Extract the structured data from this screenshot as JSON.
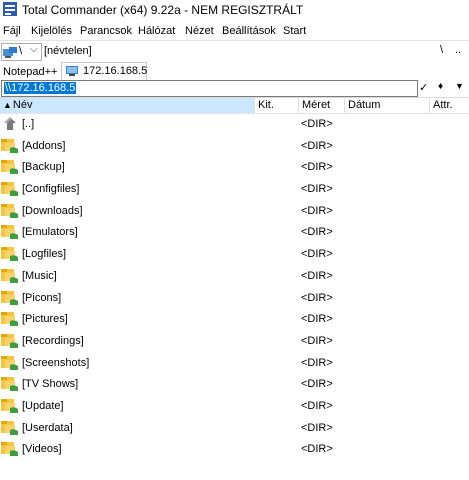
{
  "window": {
    "title": "Total Commander (x64) 9.22a - NEM REGISZTRÁLT"
  },
  "menu": [
    "Fájl",
    "Kijelölés",
    "Parancsok",
    "Hálózat",
    "Nézet",
    "Beállítások",
    "Start"
  ],
  "drivebar": {
    "drive": "\\",
    "volume_label": "[névtelen]",
    "root_button": "\\",
    "up_button": ".."
  },
  "tabs": [
    {
      "label": "Notepad++"
    },
    {
      "label": "172.16.168.5"
    }
  ],
  "path": {
    "value": "\\\\172.16.168.5",
    "check": "✓",
    "history": "♦",
    "dropdown": "▼"
  },
  "columns": {
    "name": "Név",
    "ext": "Kit.",
    "size": "Méret",
    "date": "Dátum",
    "attr": "Attr."
  },
  "files": [
    {
      "name": "[..]",
      "size": "<DIR>",
      "icon": "up-folder-icon"
    },
    {
      "name": "[Addons]",
      "size": "<DIR>",
      "icon": "folder-icon"
    },
    {
      "name": "[Backup]",
      "size": "<DIR>",
      "icon": "folder-icon"
    },
    {
      "name": "[Configfiles]",
      "size": "<DIR>",
      "icon": "folder-icon"
    },
    {
      "name": "[Downloads]",
      "size": "<DIR>",
      "icon": "folder-icon"
    },
    {
      "name": "[Emulators]",
      "size": "<DIR>",
      "icon": "folder-icon"
    },
    {
      "name": "[Logfiles]",
      "size": "<DIR>",
      "icon": "folder-icon"
    },
    {
      "name": "[Music]",
      "size": "<DIR>",
      "icon": "folder-icon"
    },
    {
      "name": "[Picons]",
      "size": "<DIR>",
      "icon": "folder-icon"
    },
    {
      "name": "[Pictures]",
      "size": "<DIR>",
      "icon": "folder-icon"
    },
    {
      "name": "[Recordings]",
      "size": "<DIR>",
      "icon": "folder-icon"
    },
    {
      "name": "[Screenshots]",
      "size": "<DIR>",
      "icon": "folder-icon"
    },
    {
      "name": "[TV Shows]",
      "size": "<DIR>",
      "icon": "folder-icon"
    },
    {
      "name": "[Update]",
      "size": "<DIR>",
      "icon": "folder-icon"
    },
    {
      "name": "[Userdata]",
      "size": "<DIR>",
      "icon": "folder-icon"
    },
    {
      "name": "[Videos]",
      "size": "<DIR>",
      "icon": "folder-icon"
    }
  ],
  "colors": {
    "accent": "#0078d7",
    "header_selected": "#cce8ff",
    "folder": "#f5c542",
    "share_green": "#3c9e3c"
  }
}
